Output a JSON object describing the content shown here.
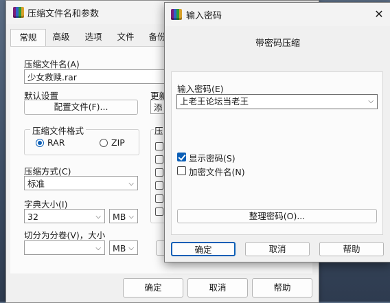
{
  "archive_dialog": {
    "title": "压缩文件名和参数",
    "tabs": [
      {
        "label": "常规"
      },
      {
        "label": "高级"
      },
      {
        "label": "选项"
      },
      {
        "label": "文件"
      },
      {
        "label": "备份"
      }
    ],
    "archive_name_label": "压缩文件名(A)",
    "archive_name_value": "少女救赎.rar",
    "default_settings_label": "默认设置",
    "profiles_button": "配置文件(F)...",
    "update_label": "更新",
    "add_partial": "添",
    "format_group_title": "压缩文件格式",
    "format_rar": "RAR",
    "format_zip": "ZIP",
    "options_group_partial": "压",
    "compression_method_label": "压缩方式(C)",
    "compression_method_value": "标准",
    "dictionary_size_label": "字典大小(I)",
    "dictionary_size_value": "32",
    "dictionary_unit": "MB",
    "split_label": "切分为分卷(V)，大小",
    "split_value": "",
    "split_unit": "MB",
    "ok_button": "确定",
    "cancel_button": "取消",
    "help_button": "帮助"
  },
  "password_dialog": {
    "title": "输入密码",
    "close_glyph": "✕",
    "subtitle": "带密码压缩",
    "enter_password_label": "输入密码(E)",
    "password_value": "上老王论坛当老王",
    "show_password_label": "显示密码(S)",
    "show_password_checked": true,
    "encrypt_filenames_label": "加密文件名(N)",
    "encrypt_filenames_checked": false,
    "organize_button": "整理密码(O)...",
    "ok_button": "确定",
    "cancel_button": "取消",
    "help_button": "帮助"
  },
  "colors": {
    "accent": "#0c5fb6",
    "dialog_bg": "#f0f0f0",
    "panel_bg": "#fbfbfb"
  }
}
